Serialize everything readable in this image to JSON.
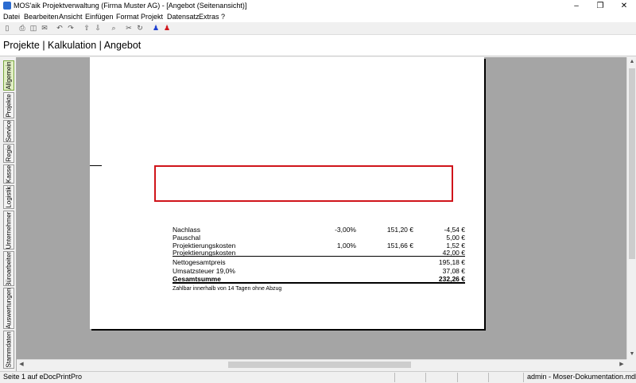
{
  "window": {
    "title": "MOS'aik Projektverwaltung (Firma Muster AG) - [Angebot (Seitenansicht)]",
    "minimize": "–",
    "restore": "❐",
    "close": "✕"
  },
  "menu": [
    "Datei",
    "Bearbeiten",
    "Ansicht",
    "Einfügen",
    "Format",
    "Projekt",
    "Datensatz",
    "Extras",
    "?"
  ],
  "toolbar_icons": [
    "new-icon",
    "print-icon",
    "print-preview-icon",
    "mail-icon",
    "undo-icon",
    "redo-icon",
    "arrow-up-icon",
    "arrow-down-icon",
    "find-icon",
    "cut-icon",
    "refresh-icon",
    "user-blue-icon",
    "user-red-icon"
  ],
  "header": {
    "breadcrumb": "Projekte | Kalkulation | Angebot"
  },
  "vtabs": [
    "Allgemein",
    "Projekte",
    "Service",
    "Regie",
    "Kasse",
    "Logistik",
    "Unternehmer",
    "Büroarbeiten",
    "Auswertungen",
    "Stammdaten"
  ],
  "document": {
    "rows": [
      {
        "label": "Nachlass",
        "pct": "-3,00%",
        "base": "151,20 €",
        "amount": "-4,54 €"
      },
      {
        "label": "Pauschal",
        "pct": "",
        "base": "",
        "amount": "5,00 €"
      },
      {
        "label": "Projektierungskosten",
        "pct": "1,00%",
        "base": "151,66 €",
        "amount": "1,52 €"
      },
      {
        "label": "Projektierungskosten",
        "pct": "",
        "base": "",
        "amount": "42,00 €"
      }
    ],
    "totals": [
      {
        "label": "Nettogesamtpreis",
        "amount": "195,18 €"
      },
      {
        "label": "Umsatzsteuer 19,0%",
        "amount": "37,08 €"
      },
      {
        "label": "Gesamtsumme",
        "amount": "232,26 €"
      }
    ],
    "payment_note": "Zahlbar innerhalb von 14 Tagen ohne Abzug"
  },
  "status": {
    "page_info": "Seite 1 auf eDocPrintPro",
    "user_db": "admin - Moser-Dokumentation.mdb"
  },
  "colors": {
    "highlight": "#d0141a",
    "active_tab": "#e2f0c6",
    "workspace": "#a5a5a5"
  }
}
